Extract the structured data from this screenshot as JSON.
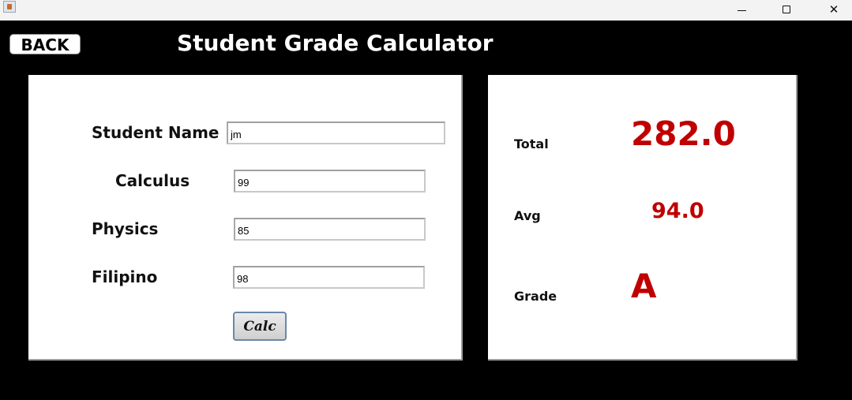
{
  "window": {
    "minimize_icon": "minimize-icon",
    "maximize_icon": "maximize-icon",
    "close_icon": "close-icon",
    "close_glyph": "✕"
  },
  "header": {
    "back_label": "BACK",
    "title": "Student Grade Calculator"
  },
  "form": {
    "student_name_label": "Student Name",
    "student_name_value": "jm",
    "calculus_label": "Calculus",
    "calculus_value": "99",
    "physics_label": "Physics",
    "physics_value": "85",
    "filipino_label": "Filipino",
    "filipino_value": "98",
    "calc_label": "Calc"
  },
  "results": {
    "total_label": "Total",
    "total_value": "282.0",
    "avg_label": "Avg",
    "avg_value": "94.0",
    "grade_label": "Grade",
    "grade_value": "A"
  },
  "colors": {
    "background": "#000000",
    "panel": "#ffffff",
    "result_value": "#c00000"
  }
}
